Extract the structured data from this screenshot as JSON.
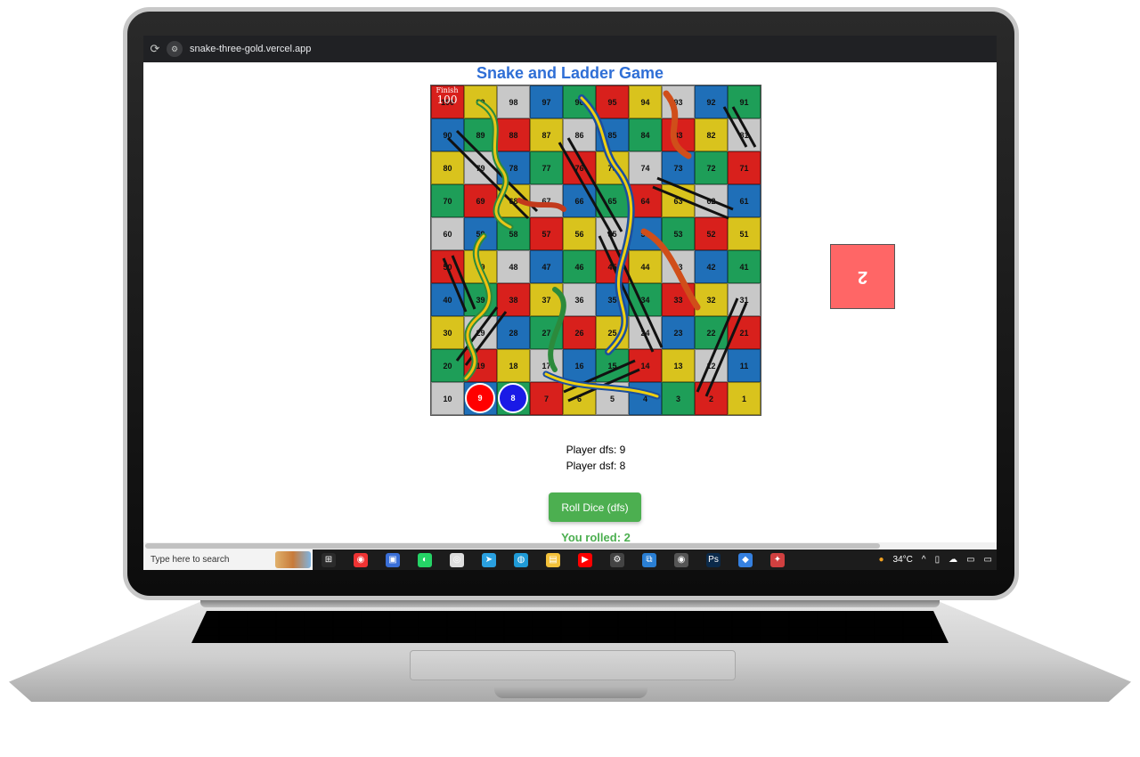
{
  "browser": {
    "url": "snake-three-gold.vercel.app",
    "reload_icon": "⟳",
    "site_info_icon": "⚙"
  },
  "page": {
    "title": "Snake and Ladder Game",
    "finish_label": "Finish",
    "finish_number": "100"
  },
  "board": {
    "rows": [
      [
        100,
        99,
        98,
        97,
        96,
        95,
        94,
        93,
        92,
        91
      ],
      [
        90,
        89,
        88,
        87,
        86,
        85,
        84,
        83,
        82,
        81
      ],
      [
        80,
        79,
        78,
        77,
        76,
        75,
        74,
        73,
        72,
        71
      ],
      [
        70,
        69,
        68,
        67,
        66,
        65,
        64,
        63,
        62,
        61
      ],
      [
        60,
        59,
        58,
        57,
        56,
        55,
        54,
        53,
        52,
        51
      ],
      [
        50,
        49,
        48,
        47,
        46,
        45,
        44,
        43,
        42,
        41
      ],
      [
        40,
        39,
        38,
        37,
        36,
        35,
        34,
        33,
        32,
        31
      ],
      [
        30,
        29,
        28,
        27,
        26,
        25,
        24,
        23,
        22,
        21
      ],
      [
        20,
        19,
        18,
        17,
        16,
        15,
        14,
        13,
        12,
        11
      ],
      [
        10,
        9,
        8,
        7,
        6,
        5,
        4,
        3,
        2,
        1
      ]
    ],
    "colors": {
      "red": "#d8201c",
      "yellow": "#d9c31d",
      "blue": "#1f6fb8",
      "green": "#1e9e58",
      "gray": "#c8c8c8"
    }
  },
  "tokens": {
    "player1": {
      "label": "9",
      "color": "#ff0000"
    },
    "player2": {
      "label": "8",
      "color": "#1a1ae6"
    }
  },
  "dice": {
    "value": "2",
    "color": "#ff6666"
  },
  "players": {
    "line1": "Player dfs: 9",
    "line2": "Player dsf: 8"
  },
  "controls": {
    "roll_button": "Roll Dice (dfs)",
    "rolled_text": "You rolled: 2",
    "accent": "#4caf50"
  },
  "taskbar": {
    "search_placeholder": "Type here to search",
    "icons": [
      "task-view-icon",
      "chrome-icon",
      "store-icon",
      "whatsapp-icon",
      "github-icon",
      "telegram-icon",
      "edge-icon",
      "file-explorer-icon",
      "youtube-icon",
      "settings-icon",
      "vscode-icon",
      "chrome-active-icon",
      "photoshop-icon",
      "paint-icon",
      "app-icon"
    ],
    "temperature": "34°C"
  }
}
